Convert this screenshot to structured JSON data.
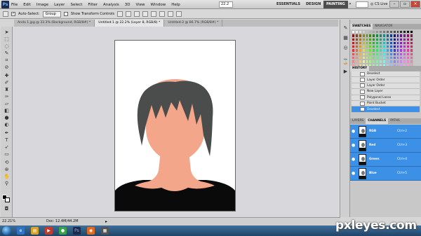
{
  "menubar": {
    "menus": [
      "File",
      "Edit",
      "Image",
      "Layer",
      "Select",
      "Filter",
      "Analysis",
      "3D",
      "View",
      "Window",
      "Help"
    ],
    "zoom": "22.2",
    "workspaces": {
      "essentials": "ESSENTIALS",
      "design": "DESIGN",
      "painting": "PAINTING"
    },
    "arrows": "»",
    "cslive": "CS Live"
  },
  "options_bar": {
    "auto_select_label": "Auto-Select:",
    "auto_select_value": "Group",
    "show_transform_label": "Show Transform Controls"
  },
  "tabs": [
    "Anda 1.jpg @ 33.3% (Background, RGB/8#) *",
    "Untitled-1 @ 22.2% (Layer 8, RGB/8) *",
    "Untitled-2 @ 66.7% (RGB/8#) *"
  ],
  "status": {
    "zoom": "22.21%",
    "doc": "Doc: 12.4M/44.2M"
  },
  "panels": {
    "swatches_tabs": [
      "SWATCHES",
      "NAVIGATOR"
    ],
    "history_title": "HISTORY",
    "history_items": [
      "Deselect",
      "Layer Order",
      "Layer Order",
      "New Layer",
      "Polygonal Lasso",
      "Paint Bucket",
      "Deselect"
    ],
    "layer_tabs": [
      "LAYERS",
      "CHANNELS",
      "PATHS"
    ],
    "channels": [
      {
        "name": "RGB",
        "shortcut": "Ctrl+2"
      },
      {
        "name": "Red",
        "shortcut": "Ctrl+3"
      },
      {
        "name": "Green",
        "shortcut": "Ctrl+4"
      },
      {
        "name": "Blue",
        "shortcut": "Ctrl+5"
      }
    ]
  },
  "taskbar": {
    "watermark": "pxleyes.com"
  },
  "colors": {
    "skin": "#f3a68a",
    "hair": "#4b4d4c",
    "shirt": "#0a0a0a",
    "selection": "#3c90e6"
  }
}
